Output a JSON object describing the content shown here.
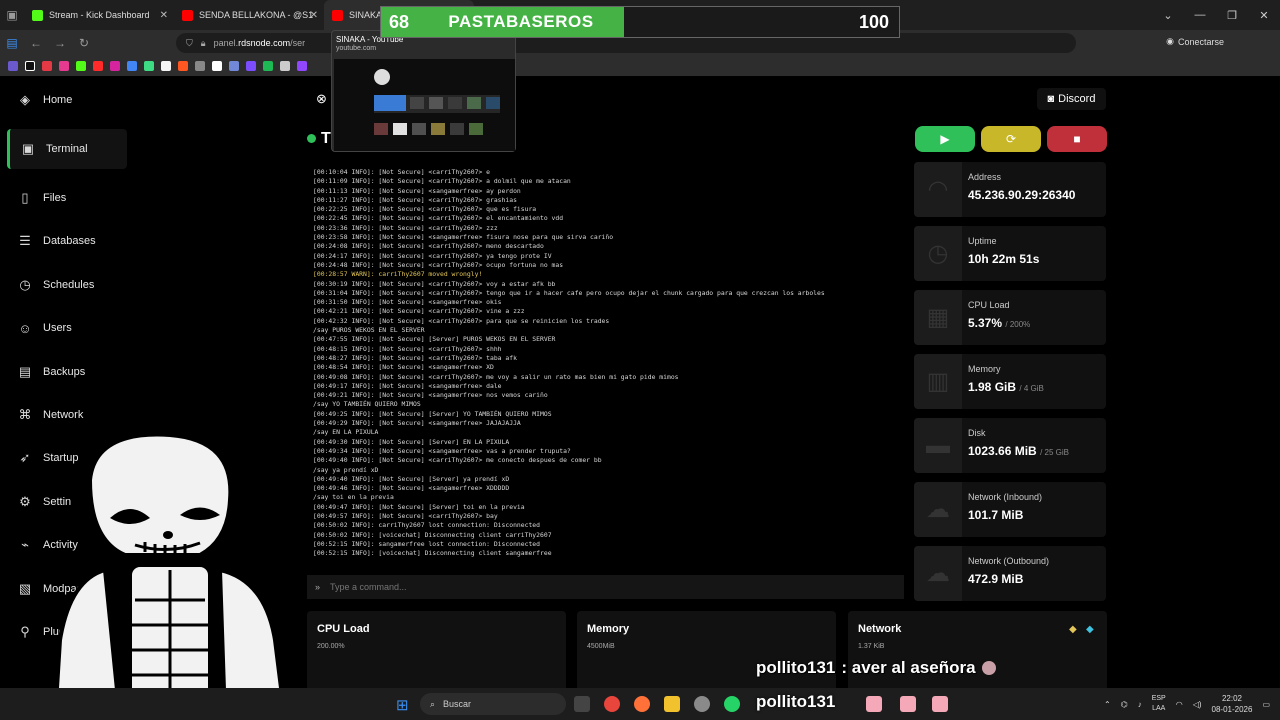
{
  "browser": {
    "tabs": [
      {
        "label": "Stream - Kick Dashboard",
        "color": "#53fc18"
      },
      {
        "label": "SENDA BELLAKONA - @S1",
        "color": "#ff0000"
      },
      {
        "label": "SINAKA",
        "color": "#ff0000"
      }
    ],
    "url_prefix": "panel.",
    "url_domain": "rdsnode.com",
    "url_rest": "/ser",
    "connect_label": "Conectarse"
  },
  "overlay": {
    "score_left": "68",
    "score_title": "PASTABASEROS",
    "score_max": "100",
    "progress_fraction": 0.68
  },
  "preview": {
    "title": "SINAKA - YouTube",
    "url": "youtube.com"
  },
  "sidebar": {
    "items": [
      {
        "label": "Home",
        "icon": "layers-icon"
      },
      {
        "label": "Terminal",
        "icon": "terminal-icon"
      },
      {
        "label": "Files",
        "icon": "file-icon"
      },
      {
        "label": "Databases",
        "icon": "database-icon"
      },
      {
        "label": "Schedules",
        "icon": "clock-icon"
      },
      {
        "label": "Users",
        "icon": "users-icon"
      },
      {
        "label": "Backups",
        "icon": "archive-icon"
      },
      {
        "label": "Network",
        "icon": "network-icon"
      },
      {
        "label": "Startup",
        "icon": "rocket-icon"
      },
      {
        "label": "Settin",
        "icon": "gear-icon"
      },
      {
        "label": "Activity",
        "icon": "activity-icon"
      },
      {
        "label": "Modpacks",
        "icon": "box-icon"
      },
      {
        "label": "Plugin",
        "icon": "plug-icon"
      }
    ],
    "active_label": "Terminal"
  },
  "header": {
    "server_initial": "T",
    "discord_label": "Discord"
  },
  "console": {
    "lines": [
      {
        "t": "[00:10:04 INFO]: [Not Secure] <carriThy2607> e"
      },
      {
        "t": "[00:11:09 INFO]: [Not Secure] <carriThy2607> a dolmil que me atacan"
      },
      {
        "t": "[00:11:13 INFO]: [Not Secure] <sangamerfree> ay perdon"
      },
      {
        "t": "[00:11:27 INFO]: [Not Secure] <carriThy2607> grashias"
      },
      {
        "t": "[00:22:25 INFO]: [Not Secure] <carriThy2607> que es fisura"
      },
      {
        "t": "[00:22:45 INFO]: [Not Secure] <carriThy2607> el encantamiento vdd"
      },
      {
        "t": "[00:23:36 INFO]: [Not Secure] <carriThy2607> zzz"
      },
      {
        "t": "[00:23:58 INFO]: [Not Secure] <sangamerfree> fisura nose para que sirva cariño"
      },
      {
        "t": "[00:24:08 INFO]: [Not Secure] <carriThy2607> meno descartado"
      },
      {
        "t": "[00:24:17 INFO]: [Not Secure] <carriThy2607> ya tengo prote IV"
      },
      {
        "t": "[00:24:48 INFO]: [Not Secure] <carriThy2607> ocupo fortuna no mas"
      },
      {
        "t": "[00:28:57 WARN]: carriThy2607 moved wrongly!",
        "warn": true
      },
      {
        "t": "[00:30:19 INFO]: [Not Secure] <carriThy2607> voy a estar afk bb"
      },
      {
        "t": "[00:31:04 INFO]: [Not Secure] <carriThy2607> tengo que ir a hacer cafe pero ocupo dejar el chunk cargado para que crezcan los arboles"
      },
      {
        "t": "[00:31:50 INFO]: [Not Secure] <sangamerfree> okis"
      },
      {
        "t": "[00:42:21 INFO]: [Not Secure] <carriThy2607> vine a zzz"
      },
      {
        "t": "[00:42:32 INFO]: [Not Secure] <carriThy2607> para que se reinicien los trades"
      },
      {
        "t": "/say PUROS WEKOS EN EL SERVER"
      },
      {
        "t": "[00:47:55 INFO]: [Not Secure] [Server] PUROS WEKOS EN EL SERVER"
      },
      {
        "t": "[00:48:15 INFO]: [Not Secure] <carriThy2607> shhh"
      },
      {
        "t": "[00:48:27 INFO]: [Not Secure] <carriThy2607> taba afk"
      },
      {
        "t": "[00:48:54 INFO]: [Not Secure] <sangamerfree> XD"
      },
      {
        "t": "[00:49:08 INFO]: [Not Secure] <carriThy2607> me voy a salir un rato mas bien mi gato pide mimos"
      },
      {
        "t": "[00:49:17 INFO]: [Not Secure] <sangamerfree> dale"
      },
      {
        "t": "[00:49:21 INFO]: [Not Secure] <sangamerfree> nos vemos cariño"
      },
      {
        "t": "/say YO TAMBIÉN QUIERO MIMOS"
      },
      {
        "t": "[00:49:25 INFO]: [Not Secure] [Server] YO TAMBIÉN QUIERO MIMOS"
      },
      {
        "t": "[00:49:29 INFO]: [Not Secure] <sangamerfree> JAJAJAJJA"
      },
      {
        "t": "/say EN LA PIXULA"
      },
      {
        "t": "[00:49:30 INFO]: [Not Secure] [Server] EN LA PIXULA"
      },
      {
        "t": "[00:49:34 INFO]: [Not Secure] <sangamerfree> vas a prender truputa?"
      },
      {
        "t": "[00:49:40 INFO]: [Not Secure] <carriThy2607> me conecto despues de comer bb"
      },
      {
        "t": "/say ya prendí xD"
      },
      {
        "t": "[00:49:40 INFO]: [Not Secure] [Server] ya prendí xD"
      },
      {
        "t": "[00:49:46 INFO]: [Not Secure] <sangamerfree> XDDDDD"
      },
      {
        "t": "/say toi en la previa"
      },
      {
        "t": "[00:49:47 INFO]: [Not Secure] [Server] toi en la previa"
      },
      {
        "t": "[00:49:57 INFO]: [Not Secure] <carriThy2607> bay"
      },
      {
        "t": "[00:50:02 INFO]: carriThy2607 lost connection: Disconnected"
      },
      {
        "t": "[00:50:02 INFO]: [voicechat] Disconnecting client carriThy2607"
      },
      {
        "t": "[00:52:15 INFO]: sangamerfree lost connection: Disconnected"
      },
      {
        "t": "[00:52:15 INFO]: [voicechat] Disconnecting client sangamerfree"
      }
    ],
    "command_placeholder": "Type a command..."
  },
  "stats": [
    {
      "label": "Address",
      "value": "45.236.90.29:26340",
      "unit": "",
      "icon": "wifi-icon"
    },
    {
      "label": "Uptime",
      "value": "10h 22m 51s",
      "unit": "",
      "icon": "clock-icon"
    },
    {
      "label": "CPU Load",
      "value": "5.37%",
      "unit": "/ 200%",
      "icon": "cpu-icon"
    },
    {
      "label": "Memory",
      "value": "1.98 GiB",
      "unit": "/ 4 GiB",
      "icon": "memory-icon"
    },
    {
      "label": "Disk",
      "value": "1023.66 MiB",
      "unit": "/ 25 GiB",
      "icon": "disk-icon"
    },
    {
      "label": "Network (Inbound)",
      "value": "101.7 MiB",
      "unit": "",
      "icon": "cloud-download-icon"
    },
    {
      "label": "Network (Outbound)",
      "value": "472.9 MiB",
      "unit": "",
      "icon": "cloud-upload-icon"
    }
  ],
  "panels": [
    {
      "title": "CPU Load",
      "scale": "200.00%"
    },
    {
      "title": "Memory",
      "scale": "4500MiB"
    },
    {
      "title": "Network",
      "scale": "1.37 KiB"
    }
  ],
  "chat": {
    "user": "pollito131",
    "message": ": aver al aseñora"
  },
  "streamer_name": "pollito131",
  "taskbar": {
    "search_label": "Buscar",
    "lang_line1": "ESP",
    "lang_line2": "LAA",
    "time": "22:02",
    "date": "08-01-2026"
  },
  "colors": {
    "accent_green": "#2fc05a",
    "play": "#2fc05a",
    "restart": "#c9b72a",
    "stop": "#c0303a"
  }
}
